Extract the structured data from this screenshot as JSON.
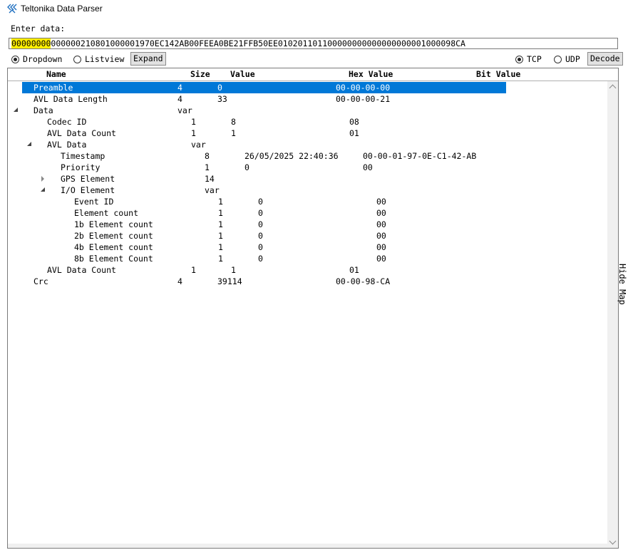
{
  "window": {
    "title": "Teltonika Data Parser",
    "icon": "teltonika-logo-icon"
  },
  "input": {
    "label": "Enter data:",
    "value_highlighted": "00000000",
    "value_rest": "000000210801000001970EC142AB00FEEA0BE21FFB50EE010201101100000000000000000001000098CA"
  },
  "view_mode": {
    "options": [
      {
        "label": "Dropdown",
        "selected": true
      },
      {
        "label": "Listview",
        "selected": false
      }
    ],
    "expand_label": "Expand"
  },
  "protocol": {
    "options": [
      {
        "label": "TCP",
        "selected": true
      },
      {
        "label": "UDP",
        "selected": false
      }
    ],
    "decode_label": "Decode"
  },
  "table": {
    "headers": {
      "name": "Name",
      "size": "Size",
      "value": "Value",
      "hex": "Hex Value",
      "bit": "Bit Value"
    },
    "rows": [
      {
        "name": "Preamble",
        "size": "4",
        "value": "0",
        "hex": "00-00-00-00",
        "selected": true
      },
      {
        "name": "AVL Data Length",
        "size": "4",
        "value": "33",
        "hex": "00-00-00-21"
      },
      {
        "name": "Data",
        "size": "var",
        "value": "",
        "hex": "",
        "expander": "open"
      },
      {
        "name": "Codec ID",
        "size": "1",
        "value": "8",
        "hex": "08"
      },
      {
        "name": "AVL Data Count",
        "size": "1",
        "value": "1",
        "hex": "01"
      },
      {
        "name": "AVL Data",
        "size": "var",
        "value": "",
        "hex": "",
        "expander": "open"
      },
      {
        "name": "Timestamp",
        "size": "8",
        "value": "26/05/2025 22:40:36",
        "hex": "00-00-01-97-0E-C1-42-AB"
      },
      {
        "name": "Priority",
        "size": "1",
        "value": "0",
        "hex": "00"
      },
      {
        "name": "GPS Element",
        "size": "14",
        "value": "",
        "hex": "",
        "expander": "closed"
      },
      {
        "name": "I/O Element",
        "size": "var",
        "value": "",
        "hex": "",
        "expander": "open"
      },
      {
        "name": "Event ID",
        "size": "1",
        "value": "0",
        "hex": "00"
      },
      {
        "name": "Element count",
        "size": "1",
        "value": "0",
        "hex": "00"
      },
      {
        "name": "1b Element count",
        "size": "1",
        "value": "0",
        "hex": "00"
      },
      {
        "name": "2b Element count",
        "size": "1",
        "value": "0",
        "hex": "00"
      },
      {
        "name": "4b Element count",
        "size": "1",
        "value": "0",
        "hex": "00"
      },
      {
        "name": "8b Element Count",
        "size": "1",
        "value": "0",
        "hex": "00"
      },
      {
        "name": "AVL Data Count",
        "size": "1",
        "value": "1",
        "hex": "01"
      },
      {
        "name": "Crc",
        "size": "4",
        "value": "39114",
        "hex": "00-00-98-CA"
      }
    ]
  },
  "side_panel": {
    "hide_map_label": "Hide Map"
  },
  "colors": {
    "selection": "#0078d7",
    "highlight": "#ffee00"
  }
}
